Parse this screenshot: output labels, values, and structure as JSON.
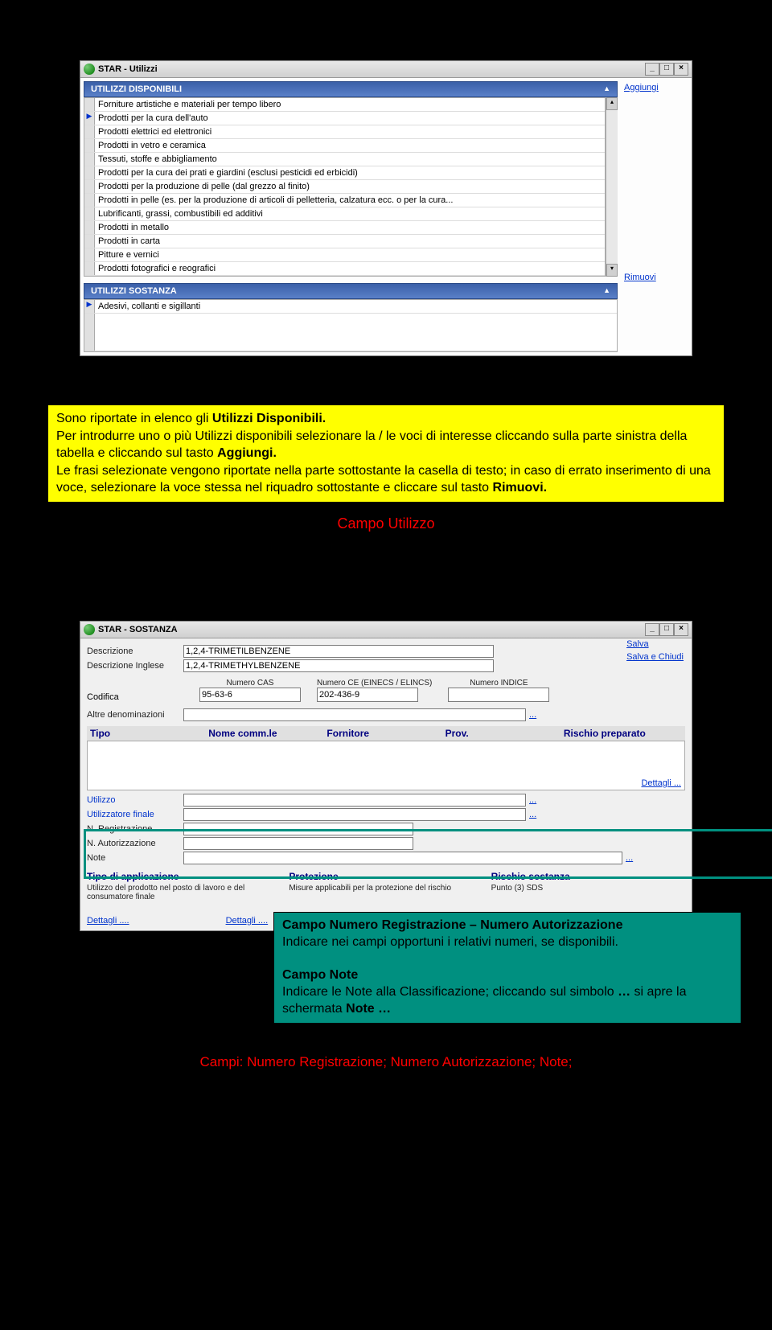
{
  "window1": {
    "title": "STAR - Utilizzi",
    "header_disponibili": "UTILIZZI DISPONIBILI",
    "header_sostanza": "UTILIZZI SOSTANZA",
    "items": [
      "Forniture artistiche e materiali per tempo libero",
      "Prodotti per la cura dell'auto",
      "Prodotti elettrici ed elettronici",
      "Prodotti in vetro e ceramica",
      "Tessuti, stoffe e abbigliamento",
      "Prodotti per la cura dei prati e giardini (esclusi pesticidi ed erbicidi)",
      "Prodotti per la produzione di pelle (dal grezzo al finito)",
      "Prodotti in pelle (es. per la produzione di articoli di pelletteria, calzatura ecc. o per la cura...",
      "Lubrificanti, grassi, combustibili ed additivi",
      "Prodotti in metallo",
      "Prodotti in carta",
      "Pitture e vernici",
      "Prodotti fotografici e reografici"
    ],
    "sostanza_items": [
      "Adesivi, collanti e sigillanti"
    ],
    "aggiungi": "Aggiungi",
    "rimuovi": "Rimuovi"
  },
  "instr1": {
    "l1a": "Sono riportate in elenco gli ",
    "l1b": "Utilizzi Disponibili.",
    "l2": "Per introdurre uno o più Utilizzi disponibili selezionare la / le voci di interesse cliccando sulla parte sinistra della tabella e cliccando sul tasto ",
    "l2b": "Aggiungi.",
    "l3": "Le frasi selezionate vengono riportate nella parte sottostante la casella di testo; in caso di errato inserimento di una voce, selezionare la voce stessa nel riquadro sottostante e cliccare sul tasto ",
    "l3b": "Rimuovi."
  },
  "caption1": "Campo Utilizzo",
  "window2": {
    "title": "STAR - SOSTANZA",
    "salva": "Salva",
    "salva_chiudi": "Salva e Chiudi",
    "lbl_descrizione": "Descrizione",
    "val_descrizione": "1,2,4-TRIMETILBENZENE",
    "lbl_desc_ing": "Descrizione Inglese",
    "val_desc_ing": "1,2,4-TRIMETHYLBENZENE",
    "lbl_codifica": "Codifica",
    "h_cas": "Numero CAS",
    "v_cas": "95-63-6",
    "h_ce": "Numero CE (EINECS / ELINCS)",
    "v_ce": "202-436-9",
    "h_indice": "Numero INDICE",
    "v_indice": "",
    "lbl_altre": "Altre denominazioni",
    "col_tipo": "Tipo",
    "col_nome": "Nome comm.le",
    "col_fornitore": "Fornitore",
    "col_prov": "Prov.",
    "col_rischio": "Rischio preparato",
    "dettagli": "Dettagli ...",
    "lbl_utilizzo": "Utilizzo",
    "lbl_utilizzatore": "Utilizzatore finale",
    "lbl_nreg": "N. Registrazione",
    "lbl_naut": "N. Autorizzazione",
    "lbl_note": "Note",
    "h_tipo_app": "Tipo di applicazione",
    "s_tipo_app": "Utilizzo del prodotto nel posto di lavoro e del consumatore finale",
    "h_protezione": "Protezione",
    "s_protezione": "Misure applicabili per la protezione del rischio",
    "h_rischio_s": "Rischio sostanza",
    "s_rischio_s": "Punto (3) SDS",
    "dettagli1": "Dettagli ....",
    "dettagli2": "Dettagli ...."
  },
  "greenbox": {
    "t1": "Campo Numero Registrazione – Numero Autorizzazione",
    "p1": "Indicare nei campi opportuni i relativi numeri, se disponibili.",
    "t2": "Campo Note",
    "p2a": "Indicare le Note alla Classificazione; cliccando sul simbolo ",
    "p2dots": "…",
    "p2b": " si apre la schermata ",
    "p2c": "Note …"
  },
  "caption2": "Campi: Numero Registrazione; Numero Autorizzazione; Note;"
}
